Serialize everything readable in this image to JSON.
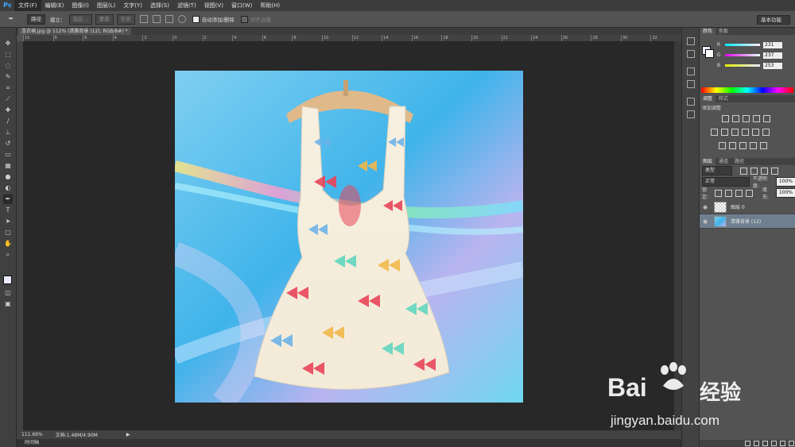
{
  "app": {
    "logo": "Ps"
  },
  "menubar": {
    "items": [
      "文件(F)",
      "编辑(E)",
      "图像(I)",
      "图层(L)",
      "文字(Y)",
      "选择(S)",
      "滤镜(T)",
      "视图(V)",
      "窗口(W)",
      "帮助(H)"
    ]
  },
  "options": {
    "mode": "路径",
    "create_label": "建立：",
    "selection_btn": "选区...",
    "mask_btn": "蒙版",
    "shape_btn": "形状",
    "auto_add_label": "自动添加/删除",
    "align_edges_label": "对齐边缘",
    "workspace": "基本功能"
  },
  "document": {
    "tab_title": "连衣裙.jpg @ 112% (清雅背景 (12), RGB/8#) *",
    "ruler_ticks": [
      "10",
      "8",
      "6",
      "4",
      "2",
      "0",
      "2",
      "4",
      "6",
      "8",
      "10",
      "12",
      "14",
      "16",
      "18",
      "20",
      "22",
      "24",
      "26",
      "28",
      "30",
      "32"
    ],
    "zoom": "111.69%",
    "doc_info": "文档:1.48M/4.90M",
    "timeline": "时间轴"
  },
  "colors": {
    "tab_color": "颜色",
    "tab_swatches": "色板",
    "r_label": "R",
    "r_value": "231",
    "g_label": "G",
    "g_value": "237",
    "b_label": "B",
    "b_value": "253",
    "fg": "#e7edfd"
  },
  "adjustments": {
    "tab_adjust": "调整",
    "tab_styles": "样式",
    "title": "添加调整"
  },
  "layers": {
    "tab_layers": "图层",
    "tab_channels": "通道",
    "tab_paths": "路径",
    "filter_kind": "类型",
    "blend_mode": "正常",
    "opacity_label": "不透明度:",
    "opacity_value": "100%",
    "lock_label": "锁定:",
    "fill_label": "填充:",
    "fill_value": "100%",
    "items": [
      {
        "name": "图层 0"
      },
      {
        "name": "清雅背景 (12)"
      }
    ]
  },
  "watermark": {
    "brand": "Bai",
    "brand2": "经验",
    "url": "jingyan.baidu.com"
  },
  "accent": "#3ea6ff"
}
